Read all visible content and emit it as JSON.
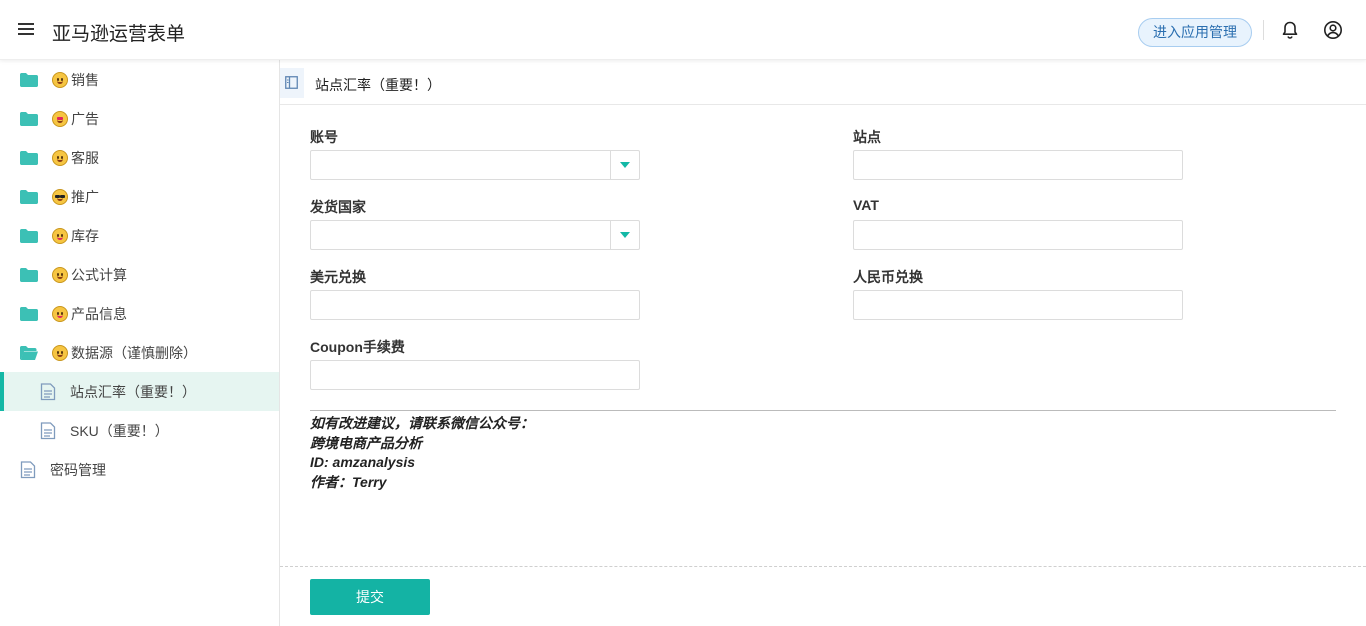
{
  "header": {
    "app_title": "亚马逊运营表单",
    "manage_button": "进入应用管理"
  },
  "sidebar": {
    "items": [
      {
        "label": "销售",
        "emoji": "slightly-smiling-face"
      },
      {
        "label": "广告",
        "emoji": "star-struck-face"
      },
      {
        "label": "客服",
        "emoji": "grinning-face"
      },
      {
        "label": "推广",
        "emoji": "sunglasses-face"
      },
      {
        "label": "库存",
        "emoji": "tongue-face"
      },
      {
        "label": "公式计算",
        "emoji": "grinning-squint-face"
      },
      {
        "label": "产品信息",
        "emoji": "tongue-out-face"
      },
      {
        "label": "数据源（谨慎删除）",
        "emoji": "thinking-face"
      }
    ],
    "children": [
      {
        "label": "站点汇率（重要！）",
        "active": true
      },
      {
        "label": "SKU（重要！）",
        "active": false
      }
    ],
    "bottom_item": {
      "label": "密码管理"
    }
  },
  "tab": {
    "title": "站点汇率（重要！）"
  },
  "form": {
    "account_label": "账号",
    "account_value": "",
    "site_label": "站点",
    "site_value": "",
    "ship_country_label": "发货国家",
    "ship_country_value": "",
    "vat_label": "VAT",
    "vat_value": "",
    "usd_label": "美元兑换",
    "usd_value": "",
    "rmb_label": "人民币兑换",
    "rmb_value": "",
    "coupon_label": "Coupon手续费",
    "coupon_value": ""
  },
  "note": {
    "line1": "如有改进建议，请联系微信公众号：",
    "line2": "跨境电商产品分析",
    "line3": "ID: amzanalysis",
    "line4": "作者：Terry"
  },
  "submit_label": "提交",
  "colors": {
    "accent": "#14b3a4",
    "active_bg": "#e6f5f1",
    "manage_bg": "#e8f3fd"
  }
}
